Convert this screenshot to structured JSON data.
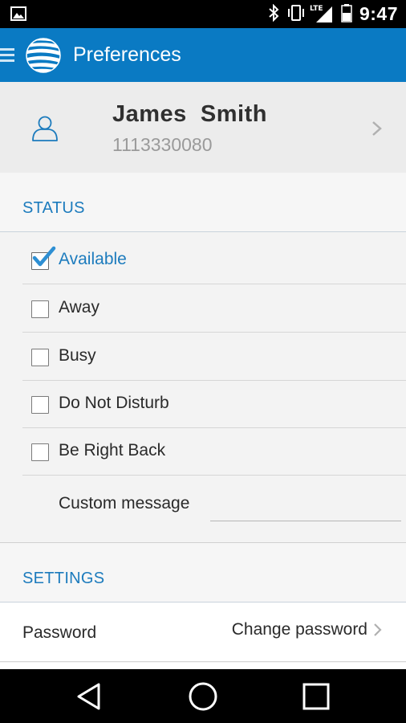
{
  "status_bar": {
    "time": "9:47",
    "network": "LTE",
    "icons": [
      "image-icon",
      "bluetooth-icon",
      "vibrate-icon",
      "signal-icon",
      "battery-icon"
    ]
  },
  "app_bar": {
    "title": "Preferences",
    "background_color": "#0a7ac3",
    "icons": [
      "menu-icon",
      "att-logo-icon"
    ]
  },
  "profile": {
    "name": "James  Smith",
    "number": "1113330080",
    "icons": [
      "user-icon",
      "chevron-right-icon"
    ]
  },
  "status_section": {
    "header": "STATUS",
    "options": [
      {
        "label": "Available",
        "checked": true
      },
      {
        "label": "Away",
        "checked": false
      },
      {
        "label": "Busy",
        "checked": false
      },
      {
        "label": "Do Not Disturb",
        "checked": false
      },
      {
        "label": "Be Right Back",
        "checked": false
      }
    ],
    "custom_message_label": "Custom message",
    "custom_message_value": ""
  },
  "settings_section": {
    "header": "SETTINGS",
    "password_label": "Password",
    "password_action": "Change password"
  },
  "nav_bar": {
    "icons": [
      "back-icon",
      "home-icon",
      "recents-icon"
    ]
  },
  "colors": {
    "accent": "#1c7bbd",
    "app_bar": "#0a7ac3"
  }
}
